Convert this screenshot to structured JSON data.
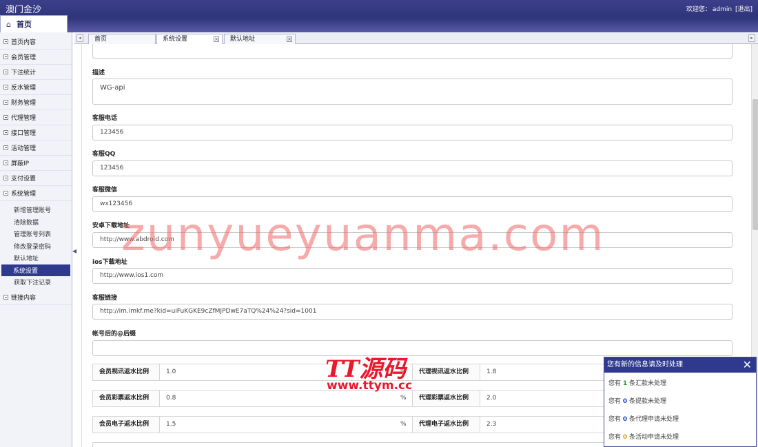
{
  "header": {
    "brand": "澳门金沙",
    "welcome": "欢迎您：",
    "user": "admin",
    "logout": "[退出]",
    "home_tab": "首页"
  },
  "sidebar": {
    "items": [
      {
        "label": "首页内容"
      },
      {
        "label": "会员管理"
      },
      {
        "label": "下注统计"
      },
      {
        "label": "反水管理"
      },
      {
        "label": "财务管理"
      },
      {
        "label": "代理管理"
      },
      {
        "label": "接口管理"
      },
      {
        "label": "活动管理"
      },
      {
        "label": "屏蔽IP"
      },
      {
        "label": "支付设置"
      },
      {
        "label": "系统管理"
      }
    ],
    "sub_items": [
      {
        "label": "新增管理账号"
      },
      {
        "label": "清除数据"
      },
      {
        "label": "管理账号列表"
      },
      {
        "label": "修改登录密码"
      },
      {
        "label": "默认地址"
      },
      {
        "label": "系统设置"
      },
      {
        "label": "获取下注记录"
      }
    ],
    "last_item": "链接内容"
  },
  "tabs": [
    {
      "label": "首页"
    },
    {
      "label": "系统设置"
    },
    {
      "label": "默认地址"
    }
  ],
  "form": {
    "desc_label": "描述",
    "desc_value": "WG-api",
    "phone_label": "客服电话",
    "phone_value": "123456",
    "qq_label": "客服QQ",
    "qq_value": "123456",
    "wechat_label": "客服微信",
    "wechat_value": "wx123456",
    "android_label": "安卓下载地址",
    "android_value": "http://www.abdroid.com",
    "ios_label": "ios下载地址",
    "ios_value": "http://www.ios1.com",
    "service_label": "客服链接",
    "service_value": "http://im.imkf.me?kid=uiFuKGKE9cZfMJPDwE7aTQ%24%24?sid=1001",
    "suffix_label": "帐号后的@后缀",
    "suffix_value": ""
  },
  "ratios": [
    {
      "member_label": "会员视讯返水比例",
      "member_value": "1.0",
      "pct": "%",
      "agent_label": "代理视讯返水比例",
      "agent_value": "1.8"
    },
    {
      "member_label": "会员彩票返水比例",
      "member_value": "0.8",
      "pct": "%",
      "agent_label": "代理彩票返水比例",
      "agent_value": "2.0"
    },
    {
      "member_label": "会员电子返水比例",
      "member_value": "1.5",
      "pct": "%",
      "agent_label": "代理电子返水比例",
      "agent_value": "2.3"
    }
  ],
  "watermarks": {
    "main": "zunyueyuanma.com",
    "tt": "TT源码",
    "url": "www.ttym.cc"
  },
  "notice": {
    "title": "您有新的信息请及时处理",
    "close": "✕",
    "lines": [
      {
        "pre": "您有 ",
        "num": "1",
        "post": " 条汇款未处理"
      },
      {
        "pre": "您有 ",
        "num": "0",
        "post": " 条提款未处理"
      },
      {
        "pre": "您有 ",
        "num": "0",
        "post": " 条代理申请未处理"
      },
      {
        "pre": "您有 ",
        "num": "0",
        "post": " 条活动申请未处理"
      }
    ]
  }
}
